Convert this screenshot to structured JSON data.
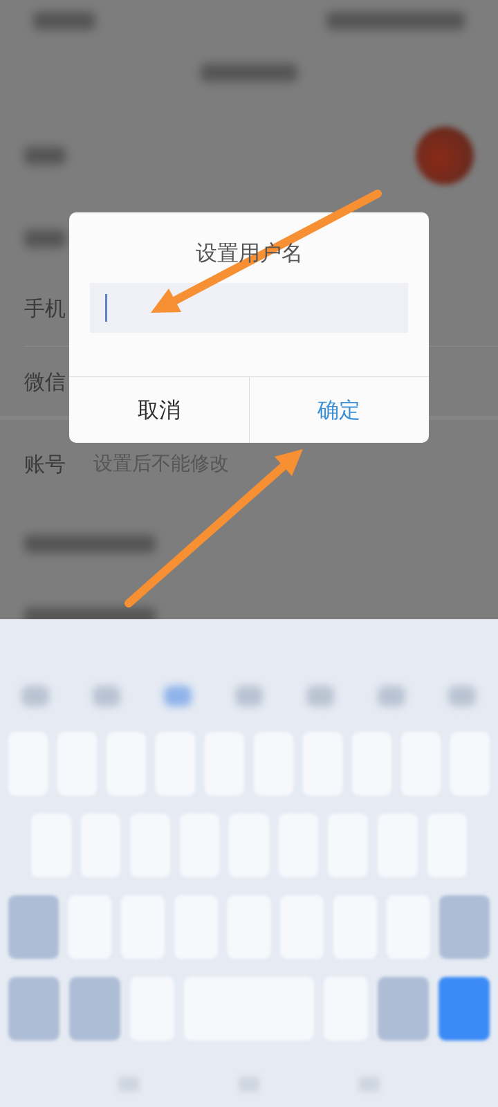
{
  "background": {
    "rows": [
      {
        "kind": "avatar"
      },
      {
        "kind": "blurred"
      },
      {
        "kind": "text",
        "label": "手机"
      },
      {
        "kind": "text",
        "label": "微信"
      },
      {
        "kind": "text",
        "label": "账号",
        "value": "设置后不能修改"
      },
      {
        "kind": "blurred"
      },
      {
        "kind": "blurred"
      }
    ]
  },
  "dialog": {
    "title": "设置用户名",
    "input": {
      "focused": true
    },
    "buttons": [
      {
        "label": "取消",
        "kind": "cancel"
      },
      {
        "label": "确定",
        "kind": "confirm"
      }
    ]
  }
}
